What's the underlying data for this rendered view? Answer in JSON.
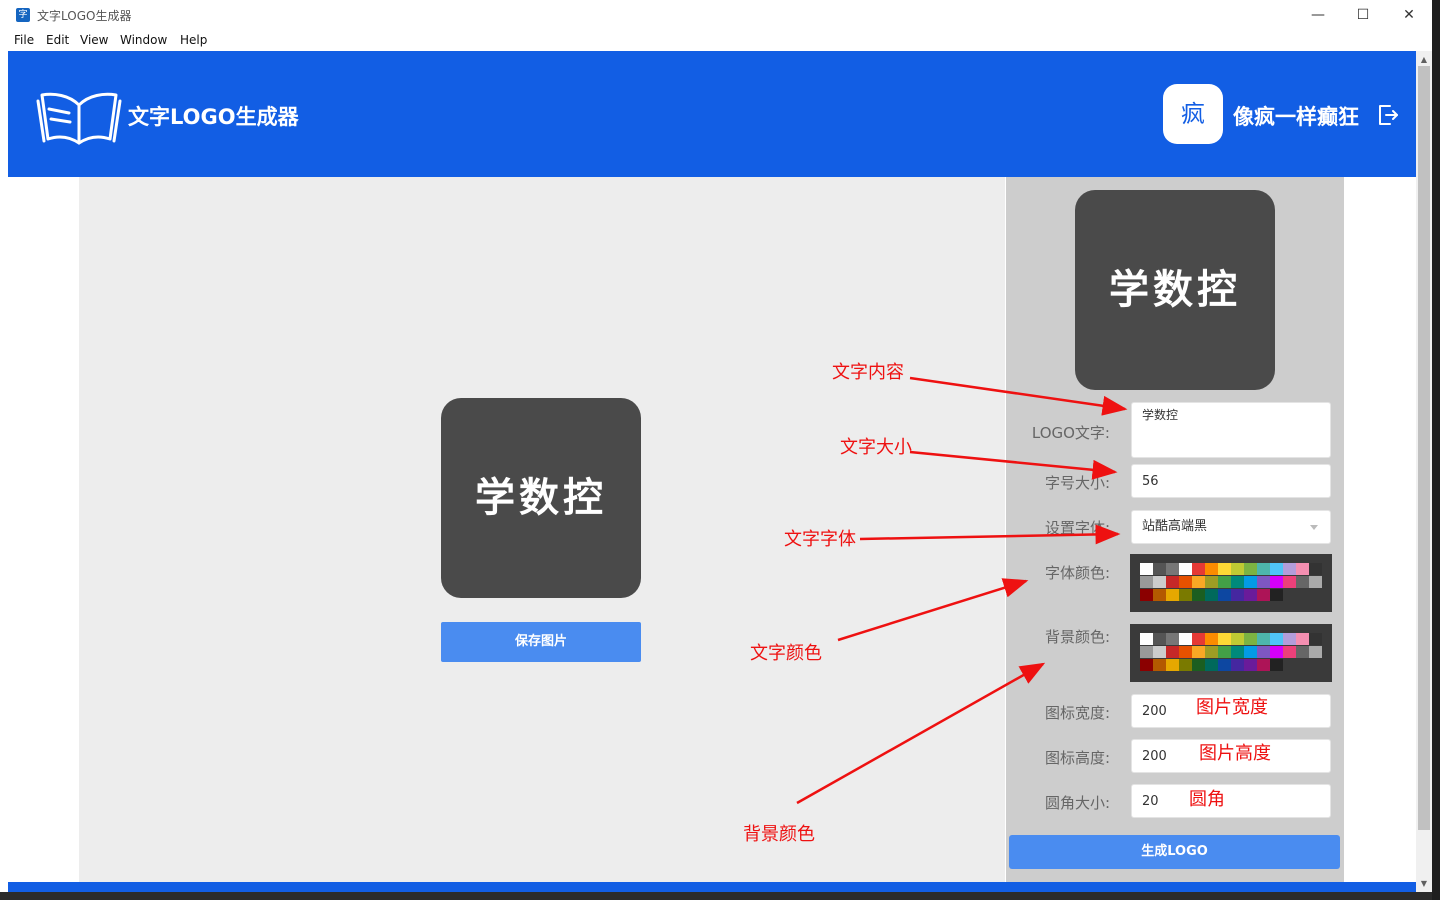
{
  "window": {
    "title": "文字LOGO生成器",
    "app_icon_glyph": "字",
    "minimize": "—",
    "maximize": "☐",
    "close": "✕"
  },
  "menu": [
    "File",
    "Edit",
    "View",
    "Window",
    "Help"
  ],
  "header": {
    "app_name": "文字LOGO生成器",
    "avatar_text": "疯",
    "username": "像疯一样癫狂",
    "brand_color": "#125ee4"
  },
  "preview": {
    "logo_text": "学数控",
    "save_label": "保存图片"
  },
  "form": {
    "logo_text_label": "LOGO文字:",
    "logo_text_value": "学数控",
    "font_size_label": "字号大小:",
    "font_size_value": "56",
    "font_label": "设置字体:",
    "font_value": "站酷高端黑",
    "font_color_label": "字体颜色:",
    "bg_color_label": "背景颜色:",
    "width_label": "图标宽度:",
    "width_value": "200",
    "height_label": "图标高度:",
    "height_value": "200",
    "radius_label": "圆角大小:",
    "radius_value": "20",
    "generate_label": "生成LOGO",
    "logo_bg_color": "#4a4a4a",
    "logo_text_color": "#ffffff"
  },
  "palette_colors": [
    [
      "#ffffff",
      "#555555",
      "#777777",
      "#ffffff",
      "#e53935",
      "#fb8c00",
      "#fdd835",
      "#c0ca33",
      "#7cb342",
      "#4db6ac",
      "#4fc3f7",
      "#b39ddb",
      "#f48fb1",
      "#333333"
    ],
    [
      "#999999",
      "#cccccc",
      "#c62828",
      "#e65100",
      "#f9a825",
      "#9e9d24",
      "#43a047",
      "#00897b",
      "#039be5",
      "#7e57c2",
      "#d500f9",
      "#ec407a",
      "#666666",
      "#aaaaaa"
    ],
    [
      "#8b0000",
      "#b35900",
      "#e6a800",
      "#7a7a00",
      "#1b5e20",
      "#00695c",
      "#0d47a1",
      "#4527a0",
      "#6a1b9a",
      "#ad1457",
      "#222222",
      "",
      "",
      ""
    ]
  ],
  "annotations": {
    "text_content": "文字内容",
    "text_size": "文字大小",
    "text_font": "文字字体",
    "text_color": "文字颜色",
    "bg_color": "背景颜色",
    "image_width": "图片宽度",
    "image_height": "图片高度",
    "corner": "圆角",
    "annotation_color": "#ee1111"
  }
}
